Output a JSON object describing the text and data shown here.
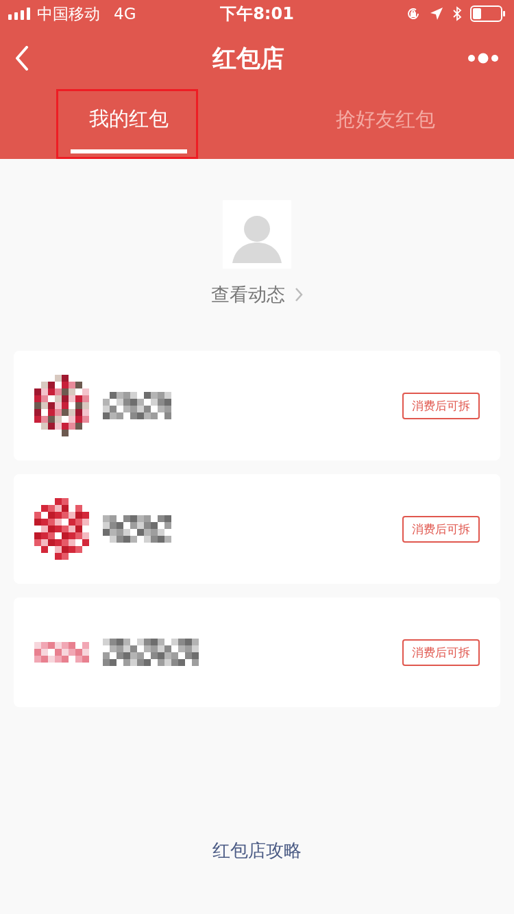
{
  "status_bar": {
    "carrier": "中国移动",
    "network": "4G",
    "time": "下午8:01"
  },
  "nav": {
    "title": "红包店"
  },
  "tabs": [
    {
      "label": "我的红包",
      "selected": true,
      "highlighted": true
    },
    {
      "label": "抢好友红包",
      "selected": false,
      "highlighted": false
    }
  ],
  "profile": {
    "link": "查看动态"
  },
  "items": [
    {
      "action": "消费后可拆"
    },
    {
      "action": "消费后可拆"
    },
    {
      "action": "消费后可拆"
    }
  ],
  "footer": {
    "link": "红包店攻略"
  }
}
